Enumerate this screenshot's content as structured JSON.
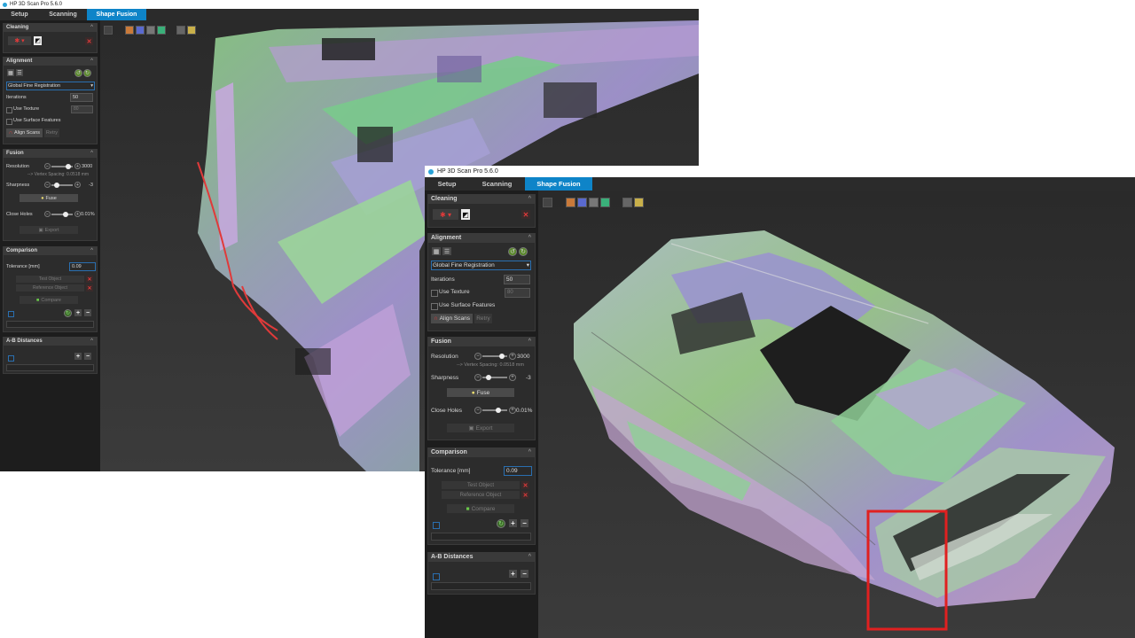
{
  "app": {
    "title": "HP 3D Scan Pro 5.6.0"
  },
  "tabs": [
    "Setup",
    "Scanning",
    "Shape Fusion"
  ],
  "active_tab": "Shape Fusion",
  "cleaning": {
    "header": "Cleaning"
  },
  "alignment": {
    "header": "Alignment",
    "method": "Global Fine Registration",
    "iterations_label": "Iterations",
    "iterations_value": "50",
    "use_texture_label": "Use Texture",
    "texture_value": "80",
    "use_surface_label": "Use Surface Features",
    "align_label": "Align Scans",
    "retry_label": "Retry"
  },
  "fusion": {
    "header": "Fusion",
    "resolution_label": "Resolution",
    "resolution_value": "3000",
    "resolution_level": 0.8,
    "vertex_spacing": "--> Vertex Spacing: 0.0518 mm",
    "sharpness_label": "Sharpness",
    "sharpness_value": "-3",
    "sharpness_level": 0.25,
    "fuse_label": "Fuse",
    "close_holes_label": "Close Holes",
    "close_holes_value": "0.01%",
    "close_holes_level": 0.65,
    "export_label": "Export"
  },
  "comparison": {
    "header": "Comparison",
    "tolerance_label": "Tolerance [mm]",
    "tolerance_value": "0.09",
    "test_object": "Test Object",
    "reference_object": "Reference Object",
    "compare_label": "Compare"
  },
  "ab": {
    "header": "A-B Distances"
  },
  "colors": {
    "accent": "#0e84c8",
    "highlight": "#e02020",
    "panel": "#2c2c2c"
  }
}
